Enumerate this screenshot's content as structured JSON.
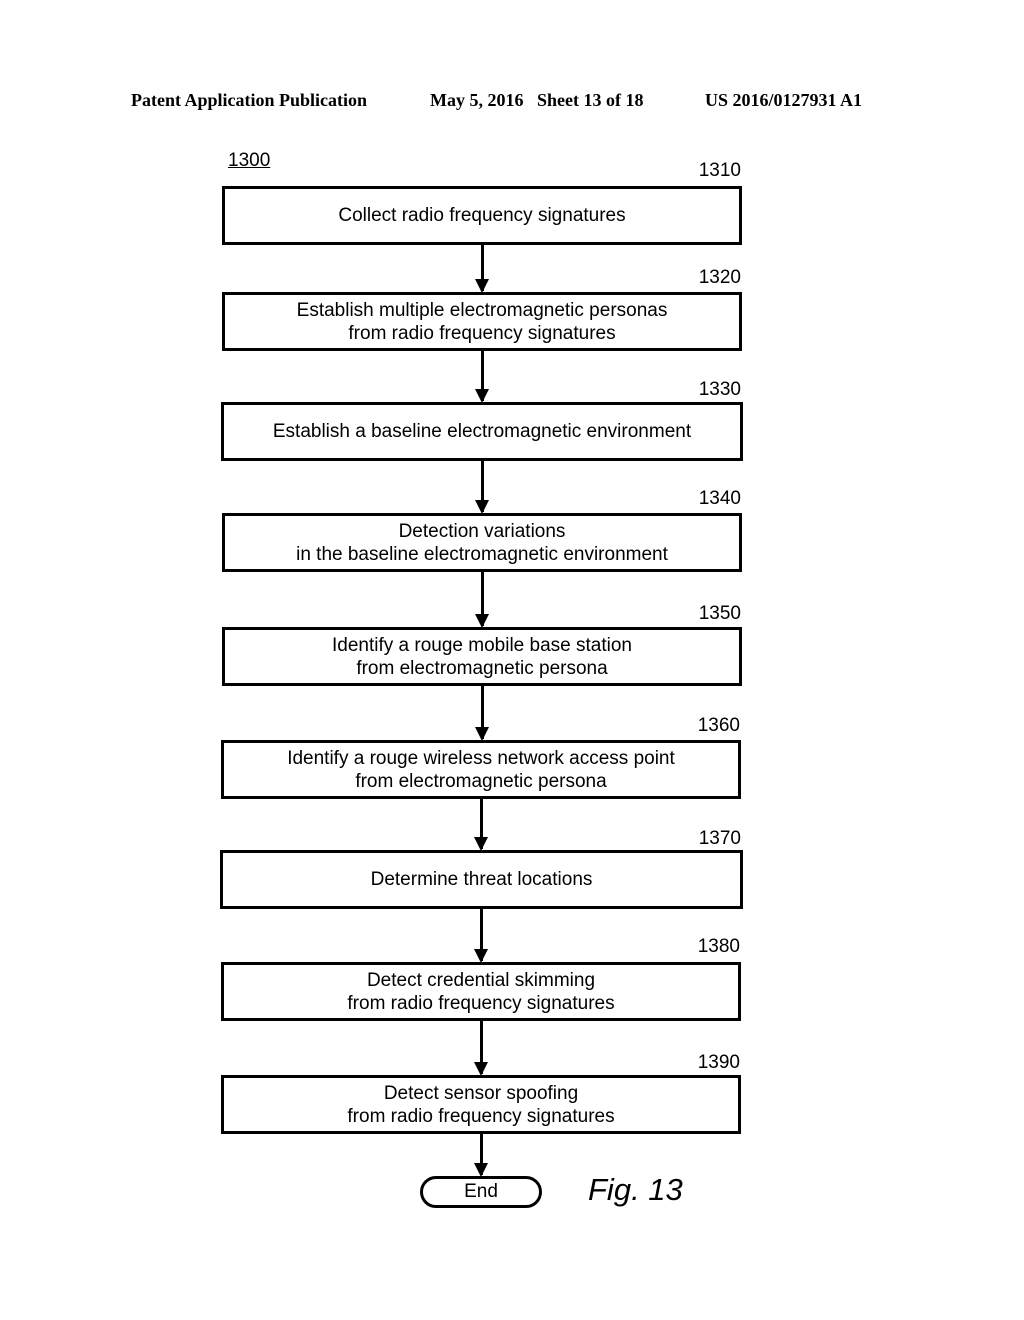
{
  "header": {
    "publication": "Patent Application Publication",
    "date_sheet": "May 5, 2016   Sheet 13 of 18",
    "patent_number": "US 2016/0127931 A1"
  },
  "figure_ref": "1300",
  "steps": [
    {
      "ref": "1310",
      "text": "Collect radio frequency signatures"
    },
    {
      "ref": "1320",
      "text": "Establish multiple electromagnetic personas\nfrom radio frequency signatures"
    },
    {
      "ref": "1330",
      "text": "Establish a baseline electromagnetic environment"
    },
    {
      "ref": "1340",
      "text": "Detection variations\nin the baseline electromagnetic environment"
    },
    {
      "ref": "1350",
      "text": "Identify a rouge mobile base station\nfrom electromagnetic persona"
    },
    {
      "ref": "1360",
      "text": "Identify a rouge wireless network access point\nfrom electromagnetic persona"
    },
    {
      "ref": "1370",
      "text": "Determine threat locations"
    },
    {
      "ref": "1380",
      "text": "Detect credential skimming\nfrom radio frequency signatures"
    },
    {
      "ref": "1390",
      "text": "Detect sensor spoofing\nfrom radio frequency signatures"
    }
  ],
  "terminal": "End",
  "figure_label": "Fig. 13"
}
